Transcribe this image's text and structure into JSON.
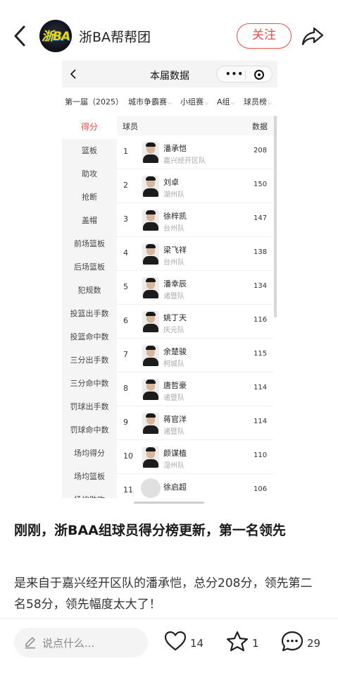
{
  "header": {
    "account_name": "浙BA帮帮团",
    "avatar_text": "浙BA",
    "follow_label": "关注"
  },
  "screenshot": {
    "nav_title": "本届数据",
    "capsule_dots": "•••",
    "filters": [
      {
        "label": "第一届（2025）",
        "has_chevron": false
      },
      {
        "label": "城市争霸赛",
        "has_chevron": true
      },
      {
        "label": "小组赛",
        "has_chevron": true
      },
      {
        "label": "A组",
        "has_chevron": true
      },
      {
        "label": "球员榜",
        "has_chevron": true
      }
    ],
    "side_items": [
      "得分",
      "篮板",
      "助攻",
      "抢断",
      "盖帽",
      "前场篮板",
      "后场篮板",
      "犯规数",
      "投篮出手数",
      "投篮命中数",
      "三分出手数",
      "三分命中数",
      "罚球出手数",
      "罚球命中数",
      "场均得分",
      "场均篮板",
      "场均助攻"
    ],
    "active_side_item": "得分",
    "table_header": {
      "player": "球员",
      "data": "数据"
    },
    "rows": [
      {
        "rank": "1",
        "name": "潘承恺",
        "team": "嘉兴经开区队",
        "value": "208"
      },
      {
        "rank": "2",
        "name": "刘卓",
        "team": "湖州队",
        "value": "150"
      },
      {
        "rank": "3",
        "name": "徐梓凯",
        "team": "台州队",
        "value": "147"
      },
      {
        "rank": "4",
        "name": "梁飞祥",
        "team": "台州队",
        "value": "138"
      },
      {
        "rank": "5",
        "name": "潘幸辰",
        "team": "诸暨队",
        "value": "134"
      },
      {
        "rank": "6",
        "name": "姚丁天",
        "team": "庆元队",
        "value": "116"
      },
      {
        "rank": "7",
        "name": "余楚骏",
        "team": "柯城队",
        "value": "115"
      },
      {
        "rank": "8",
        "name": "唐哲豪",
        "team": "诸暨队",
        "value": "114"
      },
      {
        "rank": "9",
        "name": "蒋官洋",
        "team": "诸暨队",
        "value": "114"
      },
      {
        "rank": "10",
        "name": "颜谋植",
        "team": "湿州队",
        "value": "110"
      },
      {
        "rank": "11",
        "name": "徐启超",
        "team": "",
        "value": "106"
      }
    ]
  },
  "article": {
    "headline": "刚刚，浙BAA组球员得分榜更新，第一名领先",
    "body": "是来自于嘉兴经开区队的潘承恺，总分208分，领先第二名58分，领先幅度太大了！"
  },
  "bottom_bar": {
    "comment_placeholder": "说点什么...",
    "likes": "14",
    "favorites": "1",
    "comments": "29"
  },
  "colors": {
    "accent": "#f04a4a",
    "avatar_yellow": "#f5d400"
  }
}
